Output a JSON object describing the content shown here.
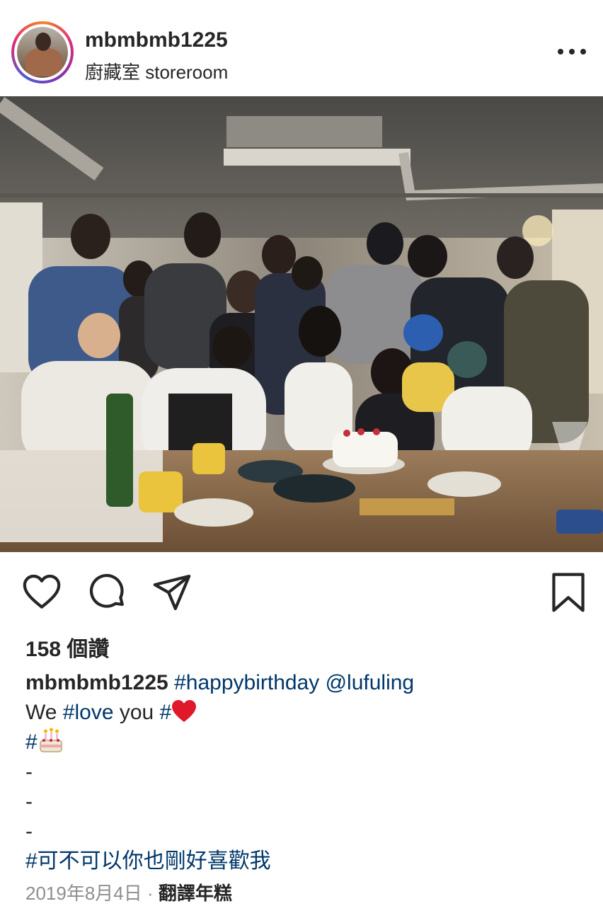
{
  "post": {
    "username": "mbmbmb1225",
    "location": "廚藏室 storeroom",
    "likes": "158 個讚",
    "caption": {
      "username": "mbmbmb1225",
      "tag1": "#happybirthday",
      "mention": "@lufuling",
      "line2_text": "We ",
      "tag2": "#love",
      "line2_text2": " you ",
      "tag3": "#",
      "heart_emoji": "❤️",
      "tag4": "#",
      "cake_emoji": "🎂",
      "dash1": "-",
      "dash2": "-",
      "dash3": "-",
      "tag5": "#可不可以你也剛好喜歡我"
    },
    "date": "2019年8月4日",
    "separator": " · ",
    "translate_label": "翻譯年糕"
  },
  "icons": {
    "more": "more-options-icon",
    "like": "heart-icon",
    "comment": "comment-icon",
    "share": "send-icon",
    "save": "bookmark-icon"
  },
  "colors": {
    "text": "#262626",
    "link": "#00376b",
    "muted": "#8e8e8e"
  }
}
